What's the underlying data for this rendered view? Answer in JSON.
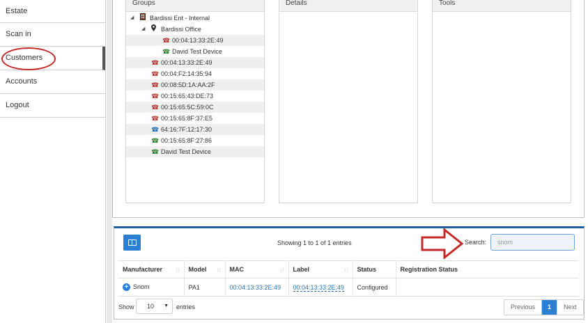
{
  "sidebar": {
    "items": [
      {
        "label": "Estate"
      },
      {
        "label": "Scan in"
      },
      {
        "label": "Customers"
      },
      {
        "label": "Accounts"
      },
      {
        "label": "Logout"
      }
    ]
  },
  "panels": {
    "groups_title": "Groups",
    "details_title": "Details",
    "tools_title": "Tools"
  },
  "tree": {
    "root": "Bardissi Ent - Internal",
    "office": "Bardissi Office",
    "office_devices": [
      {
        "label": "00:04:13:33:2E:49",
        "icon": "phone-icon",
        "color": "#b23a36"
      },
      {
        "label": "David Test Device",
        "icon": "phone-icon",
        "color": "#2e7d32"
      }
    ],
    "devices": [
      {
        "label": "00:04:13:33:2E:49",
        "icon": "phone-icon",
        "color": "#b23a36"
      },
      {
        "label": "00:04:F2:14:35:94",
        "icon": "phone-icon",
        "color": "#b23a36"
      },
      {
        "label": "00:08:5D:1A:AA:2F",
        "icon": "phone-icon",
        "color": "#b23a36"
      },
      {
        "label": "00:15:65:43:DE:73",
        "icon": "phone-icon",
        "color": "#b23a36"
      },
      {
        "label": "00:15:65:5C:59:0C",
        "icon": "phone-icon",
        "color": "#b23a36"
      },
      {
        "label": "00:15:65:8F:37:E5",
        "icon": "phone-icon",
        "color": "#b23a36"
      },
      {
        "label": "64:16:7F:12:17:30",
        "icon": "phone-icon",
        "color": "#1f6fb2"
      },
      {
        "label": "00:15:65:8F:27:86",
        "icon": "phone-icon",
        "color": "#2e7d32"
      },
      {
        "label": "David Test Device",
        "icon": "phone-icon",
        "color": "#2e7d32"
      }
    ]
  },
  "table": {
    "info": "Showing 1 to 1 of 1 entries",
    "search_label": "Search:",
    "search_value": "snom",
    "columns": [
      "Manufacturer",
      "Model",
      "MAC",
      "Label",
      "Status",
      "Registration Status"
    ],
    "rows": [
      [
        "Snom",
        "PA1",
        "00:04:13:33:2E:49",
        "00:04:13:33:2E:49",
        "Configured",
        ""
      ]
    ],
    "show_label": "Show",
    "page_length": "10",
    "entries_label": "entries",
    "pager": {
      "previous": "Previous",
      "current": "1",
      "next": "Next"
    }
  },
  "accent_color": "#2b7fd4",
  "annotation_color": "#c62828"
}
